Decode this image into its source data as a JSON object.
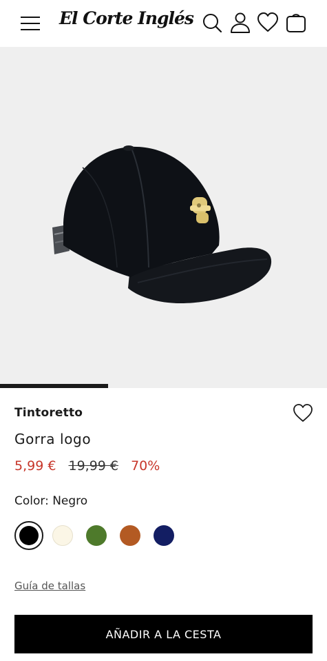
{
  "header": {
    "logo_text": "El Corte Inglés",
    "icons": [
      "menu-icon",
      "search-icon",
      "user-icon",
      "heart-icon",
      "bag-icon"
    ]
  },
  "gallery": {
    "image_alt": "Black cap with gold logo",
    "progress_fraction": 0.33
  },
  "product": {
    "brand": "Tintoretto",
    "name": "Gorra logo",
    "price_current": "5,99 €",
    "price_original": "19,99 €",
    "discount": "70%",
    "color_label": "Color: Negro",
    "swatches": [
      {
        "name": "black",
        "color": "#000000",
        "selected": true
      },
      {
        "name": "cream",
        "color": "#fbf6e6",
        "selected": false
      },
      {
        "name": "green",
        "color": "#4e7a2b",
        "selected": false
      },
      {
        "name": "brown",
        "color": "#b35a23",
        "selected": false
      },
      {
        "name": "navy",
        "color": "#131e63",
        "selected": false
      }
    ],
    "size_guide": "Guía de tallas",
    "add_to_cart": "AÑADIR A LA CESTA"
  },
  "colors": {
    "accent_red": "#c7362a",
    "gallery_bg": "#efefef",
    "button_bg": "#000000"
  }
}
